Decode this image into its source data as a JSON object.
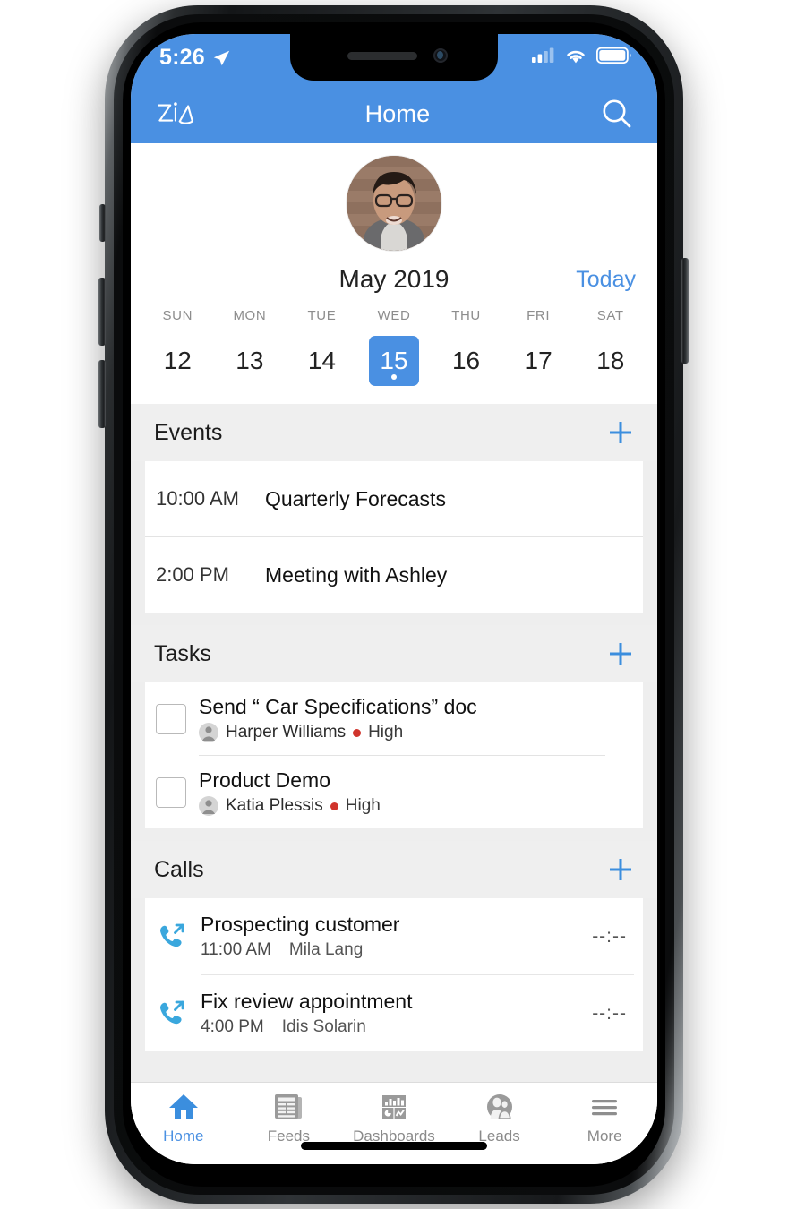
{
  "colors": {
    "accent": "#4a90e2",
    "link": "#4a90e2",
    "danger": "#d0342c",
    "section_bg": "#efefef"
  },
  "status_bar": {
    "time": "5:26",
    "location_icon": "location-arrow-icon",
    "signal_icon": "cellular-signal-icon",
    "wifi_icon": "wifi-icon",
    "battery_icon": "battery-full-icon"
  },
  "navbar": {
    "left_icon": "zia-logo-icon",
    "title": "Home",
    "right_icon": "search-icon"
  },
  "profile": {
    "avatar": "user-avatar-photo"
  },
  "calendar": {
    "month": "May 2019",
    "today_label": "Today",
    "day_names": [
      "SUN",
      "MON",
      "TUE",
      "WED",
      "THU",
      "FRI",
      "SAT"
    ],
    "days": [
      {
        "num": "12",
        "selected": false
      },
      {
        "num": "13",
        "selected": false
      },
      {
        "num": "14",
        "selected": false
      },
      {
        "num": "15",
        "selected": true
      },
      {
        "num": "16",
        "selected": false
      },
      {
        "num": "17",
        "selected": false
      },
      {
        "num": "18",
        "selected": false
      }
    ]
  },
  "events": {
    "title": "Events",
    "add_icon": "plus-icon",
    "items": [
      {
        "time": "10:00 AM",
        "title": "Quarterly Forecasts"
      },
      {
        "time": "2:00 PM",
        "title": "Meeting with Ashley"
      }
    ]
  },
  "tasks": {
    "title": "Tasks",
    "add_icon": "plus-icon",
    "items": [
      {
        "title": "Send “ Car Specifications” doc",
        "owner": "Harper Williams",
        "priority": "High"
      },
      {
        "title": "Product Demo",
        "owner": "Katia Plessis",
        "priority": "High"
      }
    ]
  },
  "calls": {
    "title": "Calls",
    "add_icon": "plus-icon",
    "items": [
      {
        "title": "Prospecting customer",
        "time": "11:00 AM",
        "contact": "Mila Lang",
        "timer": "--:--"
      },
      {
        "title": "Fix review appointment",
        "time": "4:00  PM",
        "contact": "Idis Solarin",
        "timer": "--:--"
      }
    ]
  },
  "tabbar": {
    "items": [
      {
        "label": "Home",
        "icon": "home-icon",
        "active": true
      },
      {
        "label": "Feeds",
        "icon": "newspaper-icon",
        "active": false
      },
      {
        "label": "Dashboards",
        "icon": "dashboard-charts-icon",
        "active": false
      },
      {
        "label": "Leads",
        "icon": "leads-people-icon",
        "active": false
      },
      {
        "label": "More",
        "icon": "hamburger-menu-icon",
        "active": false
      }
    ]
  }
}
